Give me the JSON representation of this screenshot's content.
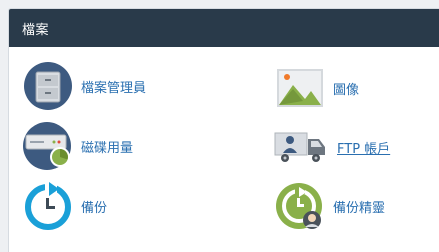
{
  "panel": {
    "title": "檔案"
  },
  "items": {
    "file_manager": {
      "label": "檔案管理員",
      "icon": "file-cabinet-icon"
    },
    "images": {
      "label": "圖像",
      "icon": "image-icon"
    },
    "disk_usage": {
      "label": "磁碟用量",
      "icon": "disk-usage-icon"
    },
    "ftp_accounts": {
      "label": "FTP 帳戶",
      "icon": "ftp-truck-icon"
    },
    "backup": {
      "label": "備份",
      "icon": "backup-clock-icon"
    },
    "backup_wizard": {
      "label": "備份精靈",
      "icon": "backup-wizard-icon"
    }
  },
  "colors": {
    "header_bg": "#293a4a",
    "link": "#2a6fb0",
    "icon_blue_dark": "#3d5a80",
    "icon_green": "#8ab04a",
    "icon_cyan": "#1aa0d8"
  }
}
